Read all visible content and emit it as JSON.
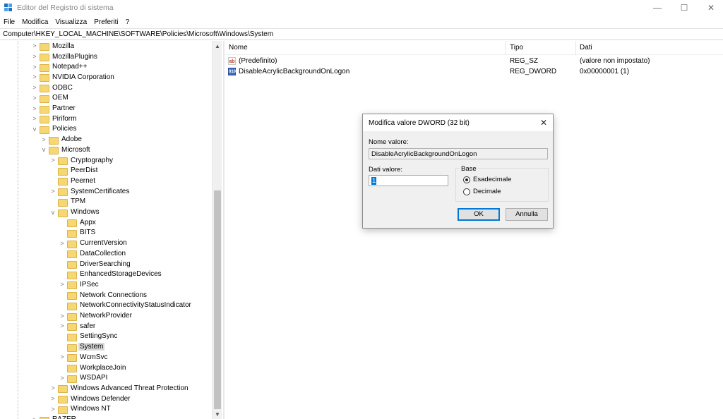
{
  "window": {
    "title": "Editor del Registro di sistema",
    "minimize": "—",
    "maximize": "☐",
    "close": "✕"
  },
  "menu": [
    "File",
    "Modifica",
    "Visualizza",
    "Preferiti",
    "?"
  ],
  "address": "Computer\\HKEY_LOCAL_MACHINE\\SOFTWARE\\Policies\\Microsoft\\Windows\\System",
  "tree": [
    {
      "label": "Mozilla",
      "chevron": ">"
    },
    {
      "label": "MozillaPlugins",
      "chevron": ">"
    },
    {
      "label": "Notepad++",
      "chevron": ">"
    },
    {
      "label": "NVIDIA Corporation",
      "chevron": ">"
    },
    {
      "label": "ODBC",
      "chevron": ">"
    },
    {
      "label": "OEM",
      "chevron": ">"
    },
    {
      "label": "Partner",
      "chevron": ">"
    },
    {
      "label": "Piriform",
      "chevron": ">"
    },
    {
      "label": "Policies",
      "chevron": "v"
    },
    {
      "label": "Adobe",
      "chevron": ">"
    },
    {
      "label": "Microsoft",
      "chevron": "v"
    },
    {
      "label": "Cryptography",
      "chevron": ">"
    },
    {
      "label": "PeerDist",
      "chevron": ""
    },
    {
      "label": "Peernet",
      "chevron": ""
    },
    {
      "label": "SystemCertificates",
      "chevron": ">"
    },
    {
      "label": "TPM",
      "chevron": ""
    },
    {
      "label": "Windows",
      "chevron": "v"
    },
    {
      "label": "Appx",
      "chevron": ""
    },
    {
      "label": "BITS",
      "chevron": ""
    },
    {
      "label": "CurrentVersion",
      "chevron": ">"
    },
    {
      "label": "DataCollection",
      "chevron": ""
    },
    {
      "label": "DriverSearching",
      "chevron": ""
    },
    {
      "label": "EnhancedStorageDevices",
      "chevron": ""
    },
    {
      "label": "IPSec",
      "chevron": ">"
    },
    {
      "label": "Network Connections",
      "chevron": ""
    },
    {
      "label": "NetworkConnectivityStatusIndicator",
      "chevron": ""
    },
    {
      "label": "NetworkProvider",
      "chevron": ">"
    },
    {
      "label": "safer",
      "chevron": ">"
    },
    {
      "label": "SettingSync",
      "chevron": ""
    },
    {
      "label": "System",
      "chevron": ""
    },
    {
      "label": "WcmSvc",
      "chevron": ">"
    },
    {
      "label": "WorkplaceJoin",
      "chevron": ""
    },
    {
      "label": "WSDAPI",
      "chevron": ">"
    },
    {
      "label": "Windows Advanced Threat Protection",
      "chevron": ">"
    },
    {
      "label": "Windows Defender",
      "chevron": ">"
    },
    {
      "label": "Windows NT",
      "chevron": ">"
    },
    {
      "label": "RAZER",
      "chevron": ">"
    }
  ],
  "selected_key": "System",
  "list": {
    "headers": {
      "name": "Nome",
      "type": "Tipo",
      "data": "Dati"
    },
    "rows": [
      {
        "icon": "string-value-icon",
        "icon_text": "ab",
        "name": "(Predefinito)",
        "type": "REG_SZ",
        "data": "(valore non impostato)"
      },
      {
        "icon": "dword-value-icon",
        "icon_text": "010",
        "name": "DisableAcrylicBackgroundOnLogon",
        "type": "REG_DWORD",
        "data": "0x00000001 (1)"
      }
    ]
  },
  "dialog": {
    "title": "Modifica valore DWORD (32 bit)",
    "close": "✕",
    "value_name_label": "Nome valore:",
    "value_name": "DisableAcrylicBackgroundOnLogon",
    "value_data_label": "Dati valore:",
    "value_data": "1",
    "base_label": "Base",
    "base_options": [
      {
        "label": "Esadecimale",
        "checked": true
      },
      {
        "label": "Decimale",
        "checked": false
      }
    ],
    "ok": "OK",
    "cancel": "Annulla"
  },
  "scrollbar": {
    "up": "▲",
    "down": "▼"
  },
  "colors": {
    "accent": "#0078d7",
    "folder": "#f7d774",
    "selection": "#d9d9d9"
  }
}
